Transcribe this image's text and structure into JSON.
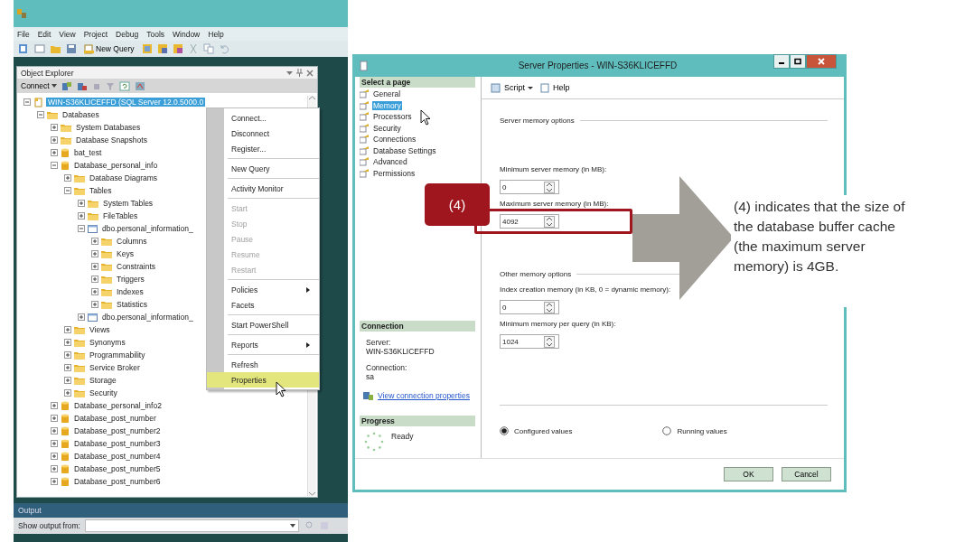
{
  "ssms": {
    "menu": [
      "File",
      "Edit",
      "View",
      "Project",
      "Debug",
      "Tools",
      "Window",
      "Help"
    ],
    "toolbar": {
      "new_query": "New Query"
    },
    "object_explorer": {
      "title": "Object Explorer",
      "connect": "Connect",
      "tree": [
        {
          "label": "WIN-S36KLICEFFD (SQL Server 12.0.5000.0",
          "kind": "server",
          "selected": true,
          "expanded": true,
          "children": [
            {
              "label": "Databases",
              "kind": "folder",
              "selected": false,
              "expanded": true,
              "children": [
                {
                  "label": "System Databases",
                  "kind": "folder",
                  "selected": false,
                  "expanded": false
                },
                {
                  "label": "Database Snapshots",
                  "kind": "folder",
                  "selected": false,
                  "expanded": false
                },
                {
                  "label": "bat_test",
                  "kind": "database",
                  "selected": false,
                  "expanded": false
                },
                {
                  "label": "Database_personal_info",
                  "kind": "database",
                  "selected": false,
                  "expanded": true,
                  "children": [
                    {
                      "label": "Database Diagrams",
                      "kind": "folder",
                      "selected": false,
                      "expanded": false
                    },
                    {
                      "label": "Tables",
                      "kind": "folder",
                      "selected": false,
                      "expanded": true,
                      "children": [
                        {
                          "label": "System Tables",
                          "kind": "folder",
                          "selected": false,
                          "expanded": false
                        },
                        {
                          "label": "FileTables",
                          "kind": "folder",
                          "selected": false,
                          "expanded": false
                        },
                        {
                          "label": "dbo.personal_information_",
                          "kind": "table",
                          "selected": false,
                          "expanded": true,
                          "children": [
                            {
                              "label": "Columns",
                              "kind": "folder",
                              "selected": false,
                              "expanded": false
                            },
                            {
                              "label": "Keys",
                              "kind": "folder",
                              "selected": false,
                              "expanded": false
                            },
                            {
                              "label": "Constraints",
                              "kind": "folder",
                              "selected": false,
                              "expanded": false
                            },
                            {
                              "label": "Triggers",
                              "kind": "folder",
                              "selected": false,
                              "expanded": false
                            },
                            {
                              "label": "Indexes",
                              "kind": "folder",
                              "selected": false,
                              "expanded": false
                            },
                            {
                              "label": "Statistics",
                              "kind": "folder",
                              "selected": false,
                              "expanded": false
                            }
                          ]
                        },
                        {
                          "label": "dbo.personal_information_",
                          "kind": "table",
                          "selected": false,
                          "expanded": false
                        }
                      ]
                    },
                    {
                      "label": "Views",
                      "kind": "folder",
                      "selected": false,
                      "expanded": false
                    },
                    {
                      "label": "Synonyms",
                      "kind": "folder",
                      "selected": false,
                      "expanded": false
                    },
                    {
                      "label": "Programmability",
                      "kind": "folder",
                      "selected": false,
                      "expanded": false
                    },
                    {
                      "label": "Service Broker",
                      "kind": "folder",
                      "selected": false,
                      "expanded": false
                    },
                    {
                      "label": "Storage",
                      "kind": "folder",
                      "selected": false,
                      "expanded": false
                    },
                    {
                      "label": "Security",
                      "kind": "folder",
                      "selected": false,
                      "expanded": false
                    }
                  ]
                },
                {
                  "label": "Database_personal_info2",
                  "kind": "database",
                  "selected": false,
                  "expanded": false
                },
                {
                  "label": "Database_post_number",
                  "kind": "database",
                  "selected": false,
                  "expanded": false
                },
                {
                  "label": "Database_post_number2",
                  "kind": "database",
                  "selected": false,
                  "expanded": false
                },
                {
                  "label": "Database_post_number3",
                  "kind": "database",
                  "selected": false,
                  "expanded": false
                },
                {
                  "label": "Database_post_number4",
                  "kind": "database",
                  "selected": false,
                  "expanded": false
                },
                {
                  "label": "Database_post_number5",
                  "kind": "database",
                  "selected": false,
                  "expanded": false
                },
                {
                  "label": "Database_post_number6",
                  "kind": "database",
                  "selected": false,
                  "expanded": false
                }
              ]
            }
          ]
        }
      ]
    },
    "context_menu": [
      [
        {
          "label": "Connect...",
          "disabled": false,
          "submenu": false,
          "selected": false
        },
        {
          "label": "Disconnect",
          "disabled": false,
          "submenu": false,
          "selected": false
        },
        {
          "label": "Register...",
          "disabled": false,
          "submenu": false,
          "selected": false
        }
      ],
      [
        {
          "label": "New Query",
          "disabled": false,
          "submenu": false,
          "selected": false
        }
      ],
      [
        {
          "label": "Activity Monitor",
          "disabled": false,
          "submenu": false,
          "selected": false
        }
      ],
      [
        {
          "label": "Start",
          "disabled": true,
          "submenu": false,
          "selected": false
        },
        {
          "label": "Stop",
          "disabled": true,
          "submenu": false,
          "selected": false
        },
        {
          "label": "Pause",
          "disabled": true,
          "submenu": false,
          "selected": false
        },
        {
          "label": "Resume",
          "disabled": true,
          "submenu": false,
          "selected": false
        },
        {
          "label": "Restart",
          "disabled": true,
          "submenu": false,
          "selected": false
        }
      ],
      [
        {
          "label": "Policies",
          "disabled": false,
          "submenu": true,
          "selected": false
        },
        {
          "label": "Facets",
          "disabled": false,
          "submenu": false,
          "selected": false
        }
      ],
      [
        {
          "label": "Start PowerShell",
          "disabled": false,
          "submenu": false,
          "selected": false
        }
      ],
      [
        {
          "label": "Reports",
          "disabled": false,
          "submenu": true,
          "selected": false
        }
      ],
      [
        {
          "label": "Refresh",
          "disabled": false,
          "submenu": false,
          "selected": false
        },
        {
          "label": "Properties",
          "disabled": false,
          "submenu": false,
          "selected": true
        }
      ]
    ],
    "output": {
      "title": "Output",
      "label": "Show output from:"
    }
  },
  "dialog": {
    "title": "Server Properties - WIN-S36KLICEFFD",
    "select_page": {
      "heading": "Select a page",
      "pages": [
        {
          "label": "General",
          "selected": false
        },
        {
          "label": "Memory",
          "selected": true
        },
        {
          "label": "Processors",
          "selected": false
        },
        {
          "label": "Security",
          "selected": false
        },
        {
          "label": "Connections",
          "selected": false
        },
        {
          "label": "Database Settings",
          "selected": false
        },
        {
          "label": "Advanced",
          "selected": false
        },
        {
          "label": "Permissions",
          "selected": false
        }
      ]
    },
    "toolbar": {
      "script": "Script",
      "help": "Help"
    },
    "server_memory": {
      "heading": "Server memory options",
      "fields": [
        {
          "label": "Minimum server memory (in MB):",
          "value": "0",
          "highlighted": false
        },
        {
          "label": "Maximum server memory (in MB):",
          "value": "4092",
          "highlighted": true
        }
      ]
    },
    "other_memory": {
      "heading": "Other memory options",
      "fields": [
        {
          "label": "Index creation memory (in KB, 0 = dynamic memory):",
          "value": "0"
        },
        {
          "label": "Minimum memory per query (in KB):",
          "value": "1024"
        }
      ]
    },
    "radios": [
      {
        "label": "Configured values",
        "selected": true
      },
      {
        "label": "Running values",
        "selected": false
      }
    ],
    "connection": {
      "heading": "Connection",
      "server_label": "Server:",
      "server": "WIN-S36KLICEFFD",
      "connection_label": "Connection:",
      "connection": "sa",
      "link": "View connection properties"
    },
    "progress": {
      "heading": "Progress",
      "status": "Ready"
    },
    "buttons": [
      "OK",
      "Cancel"
    ]
  },
  "callout": {
    "marker": "(4)",
    "text": "(4) indicates that the size of the database buffer cache (the maximum server memory) is 4GB."
  }
}
